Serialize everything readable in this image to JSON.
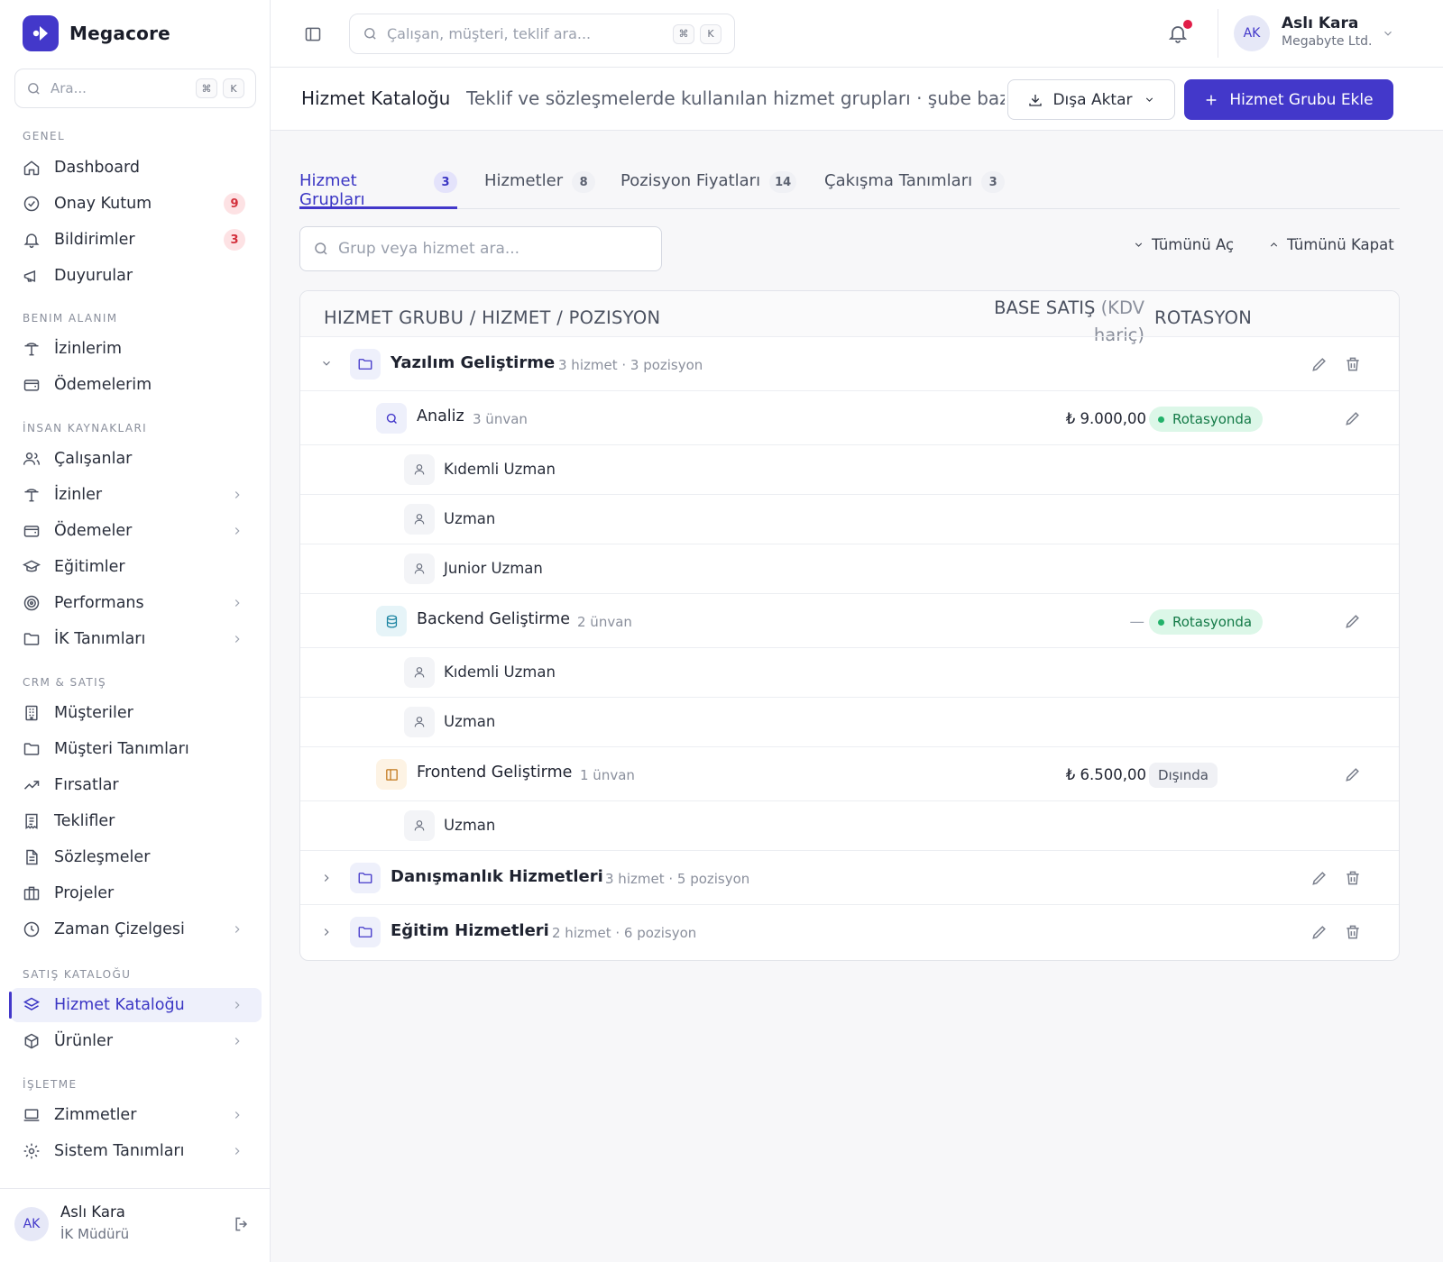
{
  "brand": {
    "name": "Megacore"
  },
  "sidebar": {
    "search_placeholder": "Ara...",
    "shortcut_cmd": "⌘",
    "shortcut_key": "K",
    "sections": {
      "genel": "GENEL",
      "benim": "BENIM ALANIM",
      "ik": "İNSAN KAYNAKLARI",
      "crm": "CRM & SATIŞ",
      "katalog": "SATIŞ KATALOĞU",
      "isletme": "İŞLETME"
    },
    "items": {
      "dashboard": "Dashboard",
      "onay": "Onay Kutum",
      "onay_badge": "9",
      "bildirimler": "Bildirimler",
      "bildirimler_badge": "3",
      "duyurular": "Duyurular",
      "izinlerim": "İzinlerim",
      "odemelerim": "Ödemelerim",
      "calisanlar": "Çalışanlar",
      "izinler": "İzinler",
      "odemeler": "Ödemeler",
      "egitimler": "Eğitimler",
      "performans": "Performans",
      "ik_tanimlari": "İK Tanımları",
      "musteriler": "Müşteriler",
      "musteri_tanimlari": "Müşteri Tanımları",
      "firsatlar": "Fırsatlar",
      "teklifler": "Teklifler",
      "sozlesmeler": "Sözleşmeler",
      "projeler": "Projeler",
      "zaman": "Zaman Çizelgesi",
      "hizmet_katalogu": "Hizmet Kataloğu",
      "urunler": "Ürünler",
      "zimmetler": "Zimmetler",
      "sistem": "Sistem Tanımları"
    },
    "user": {
      "initials": "AK",
      "name": "Aslı Kara",
      "role": "İK Müdürü"
    }
  },
  "topbar": {
    "search_placeholder": "Çalışan, müşteri, teklif ara...",
    "shortcut_cmd": "⌘",
    "shortcut_key": "K",
    "user": {
      "initials": "AK",
      "name": "Aslı Kara",
      "company": "Megabyte Ltd."
    }
  },
  "page": {
    "title": "Hizmet Kataloğu",
    "subtitle": "Teklif ve sözleşmelerde kullanılan hizmet grupları · şube bazlı",
    "export_label": "Dışa Aktar",
    "add_label": "Hizmet Grubu Ekle"
  },
  "tabs": [
    {
      "label": "Hizmet Grupları",
      "count": "3"
    },
    {
      "label": "Hizmetler",
      "count": "8"
    },
    {
      "label": "Pozisyon Fiyatları",
      "count": "14"
    },
    {
      "label": "Çakışma Tanımları",
      "count": "3"
    }
  ],
  "filters": {
    "search_placeholder": "Grup veya hizmet ara...",
    "expand_all": "Tümünü Aç",
    "collapse_all": "Tümünü Kapat"
  },
  "table": {
    "headers": {
      "name": "HIZMET GRUBU / HIZMET / POZISYON",
      "price_main": "BASE SATIŞ",
      "price_note1": "(KDV",
      "price_note2": "hariç)",
      "rotation": "ROTASYON"
    },
    "groups": [
      {
        "name": "Yazılım Geliştirme",
        "meta": "3 hizmet · 3 pozisyon",
        "services": [
          {
            "name": "Analiz",
            "meta": "3 ünvan",
            "price": "₺ 9.000,00",
            "rotation": "Rotasyonda",
            "positions": [
              "Kıdemli Uzman",
              "Uzman",
              "Junior Uzman"
            ]
          },
          {
            "name": "Backend Geliştirme",
            "meta": "2 ünvan",
            "price": "—",
            "rotation": "Rotasyonda",
            "positions": [
              "Kıdemli Uzman",
              "Uzman"
            ]
          },
          {
            "name": "Frontend Geliştirme",
            "meta": "1 ünvan",
            "price": "₺ 6.500,00",
            "rotation": "Dışında",
            "positions": [
              "Uzman"
            ]
          }
        ]
      },
      {
        "name": "Danışmanlık Hizmetleri",
        "meta": "3 hizmet · 5 pozisyon"
      },
      {
        "name": "Eğitim Hizmetleri",
        "meta": "2 hizmet · 6 pozisyon"
      }
    ]
  },
  "colors": {
    "accent": "#4338ca",
    "badge_red": "#d32f3b",
    "notif_dot": "#e11d48",
    "rot_on_bg": "#dcf7e8",
    "rot_on_text": "#137a47"
  }
}
